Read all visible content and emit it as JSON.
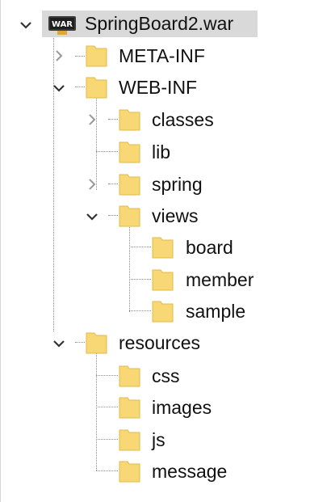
{
  "project_explorer": {
    "nodes": [
      {
        "label": "SpringBoard2.war",
        "icon": "war-archive-icon",
        "expanded": true
      },
      {
        "label": "META-INF",
        "icon": "folder-icon",
        "expanded": false
      },
      {
        "label": "WEB-INF",
        "icon": "folder-icon",
        "expanded": true
      },
      {
        "label": "classes",
        "icon": "folder-icon",
        "expanded": false
      },
      {
        "label": "lib",
        "icon": "folder-icon"
      },
      {
        "label": "spring",
        "icon": "folder-icon",
        "expanded": false
      },
      {
        "label": "views",
        "icon": "folder-icon",
        "expanded": true
      },
      {
        "label": "board",
        "icon": "folder-icon"
      },
      {
        "label": "member",
        "icon": "folder-icon"
      },
      {
        "label": "sample",
        "icon": "folder-icon"
      },
      {
        "label": "resources",
        "icon": "folder-icon",
        "expanded": true
      },
      {
        "label": "css",
        "icon": "folder-icon"
      },
      {
        "label": "images",
        "icon": "folder-icon"
      },
      {
        "label": "js",
        "icon": "folder-icon"
      },
      {
        "label": "message",
        "icon": "folder-icon"
      }
    ],
    "war_badge_text": "WAR",
    "colors": {
      "folder_fill": "#f8d775",
      "folder_edge": "#e0b94a",
      "selection": "#d9d9d9",
      "chevron": "#333333",
      "chevron_collapsed": "#999999"
    }
  }
}
